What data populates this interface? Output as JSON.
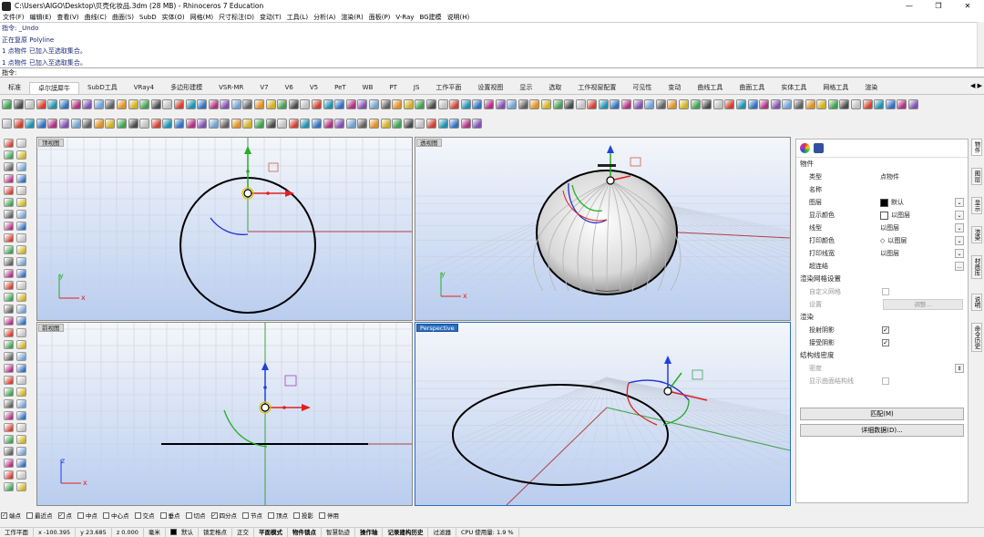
{
  "window": {
    "title": "C:\\Users\\AIGO\\Desktop\\贝壳化妆品.3dm (28 MB) - Rhinoceros 7 Education",
    "minimize": "—",
    "maximize": "❐",
    "close": "✕"
  },
  "menu": [
    "文件(F)",
    "编辑(E)",
    "查看(V)",
    "曲线(C)",
    "曲面(S)",
    "SubD",
    "实体(O)",
    "网格(M)",
    "尺寸标注(D)",
    "变动(T)",
    "工具(L)",
    "分析(A)",
    "渲染(R)",
    "面板(P)",
    "V-Ray",
    "BG建模",
    "说明(H)"
  ],
  "command_history": [
    "指令: _Undo",
    "正在复原 Polyline",
    "1 点物件 已加入至选取集合。",
    "1 点物件 已加入至选取集合。"
  ],
  "command_prompt": "指令:",
  "command_input": "",
  "tabs": [
    "标准",
    "卓尔謨犀牛",
    "SubD工具",
    "VRay4",
    "多边形建模",
    "VSR-MR",
    "V7",
    "V6",
    "V5",
    "PeT",
    "WB",
    "PT",
    "JS",
    "工作平面",
    "设置视图",
    "显示",
    "选取",
    "工作视窗配置",
    "可见性",
    "变动",
    "曲线工具",
    "曲面工具",
    "实体工具",
    "网格工具",
    "渲染"
  ],
  "active_tab_index": 1,
  "tab_scroll": "◀ ▶",
  "viewports": {
    "top": {
      "label": "顶视图"
    },
    "perspective_alt": {
      "label": "透视图"
    },
    "front": {
      "label": "前视图"
    },
    "perspective": {
      "label": "Perspective"
    }
  },
  "axis_labels": {
    "x": "x",
    "y": "y",
    "z": "z"
  },
  "properties_panel": {
    "section_object": "物件",
    "rows": [
      {
        "label": "类型",
        "value": "点物件"
      },
      {
        "label": "名称",
        "value": ""
      },
      {
        "label": "图层",
        "value": "默认"
      },
      {
        "label": "显示颜色",
        "value": "以图层"
      },
      {
        "label": "线型",
        "value": "以图层"
      },
      {
        "label": "打印颜色",
        "value": "以图层"
      },
      {
        "label": "打印线宽",
        "value": "以图层"
      },
      {
        "label": "超连结",
        "value": ""
      }
    ],
    "section_render_mesh": "渲染网格设置",
    "custom_mesh_label": "自定义网格",
    "settings_label": "设置",
    "adjust_button": "调整...",
    "section_render": "渲染",
    "cast_shadows_label": "投射阴影",
    "receive_shadows_label": "接受阴影",
    "section_isocurve": "结构线密度",
    "density_label": "密度",
    "show_iso_label": "显示曲面结构线",
    "match_button": "匹配(M)",
    "details_button": "详细数据(D)...",
    "side_tabs": [
      "物件",
      "图层",
      "显示",
      "渲染",
      "材质库",
      "说明",
      "命令历史"
    ]
  },
  "osnap": [
    {
      "label": "端点",
      "checked": true
    },
    {
      "label": "最近点",
      "checked": false
    },
    {
      "label": "点",
      "checked": true
    },
    {
      "label": "中点",
      "checked": false
    },
    {
      "label": "中心点",
      "checked": false
    },
    {
      "label": "交点",
      "checked": false
    },
    {
      "label": "垂点",
      "checked": false
    },
    {
      "label": "切点",
      "checked": false
    },
    {
      "label": "四分点",
      "checked": true
    },
    {
      "label": "节点",
      "checked": false
    },
    {
      "label": "顶点",
      "checked": false
    },
    {
      "label": "投影",
      "checked": false
    },
    {
      "label": "停用",
      "checked": false
    }
  ],
  "status": {
    "cplane": "工作平面",
    "x": "x -100.395",
    "y": "y 23.685",
    "z": "z 0.000",
    "unit": "毫米",
    "layer": "默认",
    "grid_snap": "锁定格点",
    "ortho": "正交",
    "planar": "平面模式",
    "osnap": "物件锁点",
    "smarttrack": "智慧轨迹",
    "gumball": "操作轴",
    "history": "记录建构历史",
    "filter": "过滤器",
    "cpu": "CPU 使用量: 1.9 %"
  },
  "colors": {
    "accent": "#2a6fc0",
    "x_axis": "#e02020",
    "y_axis": "#20b020",
    "z_axis": "#2040e0",
    "viewport_top": "#f4f6fa",
    "viewport_bottom": "#b9cdf0"
  }
}
